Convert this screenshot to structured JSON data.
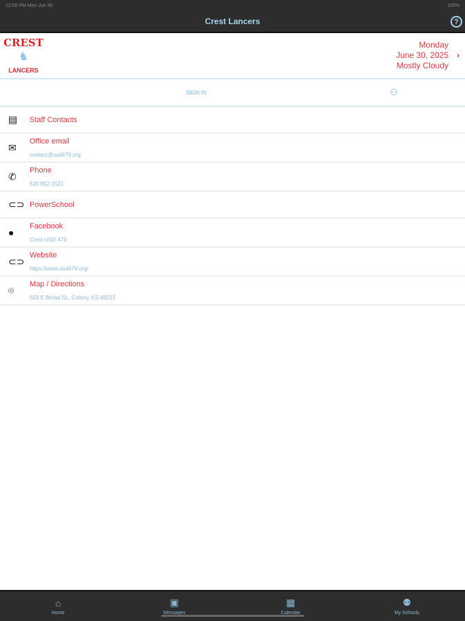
{
  "status": {
    "time": "12:00 PM  Mon Jun 30",
    "battery": "100%"
  },
  "nav": {
    "title": "Crest Lancers",
    "help_icon": "?"
  },
  "logo": {
    "top": "CREST",
    "bottom": "LANCERS"
  },
  "date": {
    "day": "Monday",
    "date": "June 30, 2025",
    "weather": "Mostly Cloudy"
  },
  "signin": {
    "label": "SIGN IN"
  },
  "items": [
    {
      "title": "Staff Contacts",
      "sub": "",
      "icon": "list-icon"
    },
    {
      "title": "Office email",
      "sub": "contact@usd479.org",
      "icon": "mail-icon"
    },
    {
      "title": "Phone",
      "sub": "620 852-3521",
      "icon": "phone-icon"
    },
    {
      "title": "PowerSchool",
      "sub": "",
      "icon": "link-icon"
    },
    {
      "title": "Facebook",
      "sub": "Crest USD 479",
      "icon": "facebook-icon"
    },
    {
      "title": "Website",
      "sub": "https://www.usd479.org/",
      "icon": "link-icon"
    },
    {
      "title": "Map / Directions",
      "sub": "603 E Broad St., Colony, KS 66015",
      "icon": "map-pin-icon"
    }
  ],
  "tabs": [
    {
      "label": "Home"
    },
    {
      "label": "Messages"
    },
    {
      "label": "Calendar"
    },
    {
      "label": "My Schools"
    }
  ]
}
